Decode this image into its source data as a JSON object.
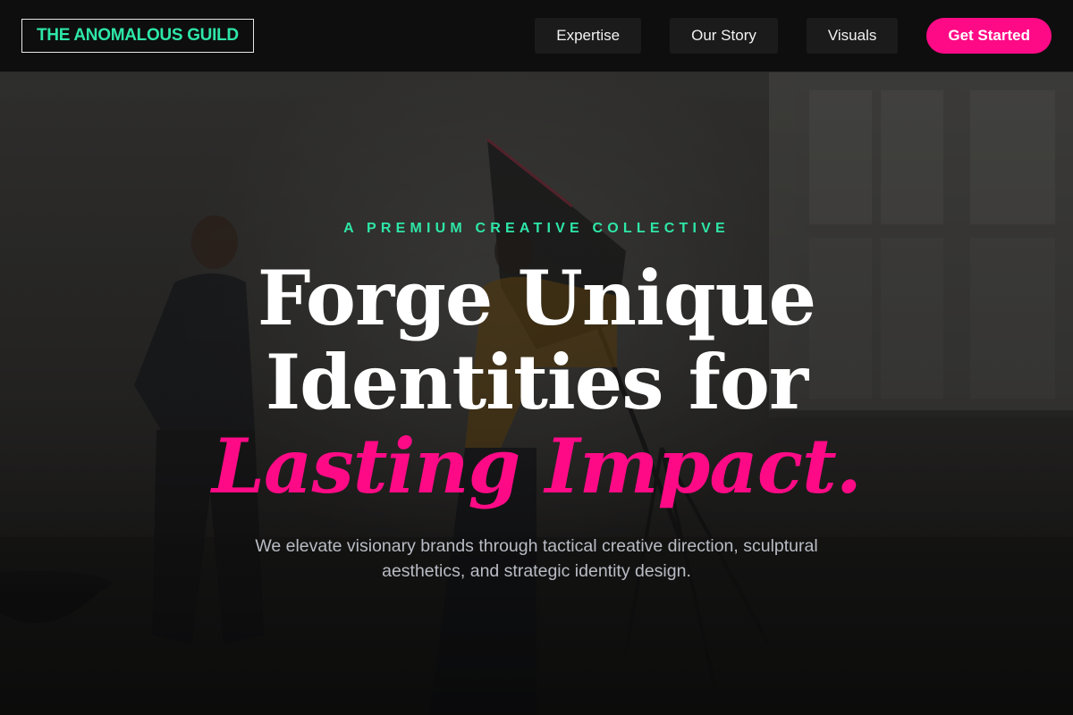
{
  "brand": {
    "name": "THE ANOMALOUS GUILD"
  },
  "nav": {
    "links": [
      {
        "label": "Expertise"
      },
      {
        "label": "Our Story"
      },
      {
        "label": "Visuals"
      }
    ],
    "cta_label": "Get Started"
  },
  "hero": {
    "eyebrow": "A PREMIUM CREATIVE COLLECTIVE",
    "headline_line1": "Forge Unique",
    "headline_line2": "Identities for",
    "headline_accent": "Lasting Impact.",
    "subtext": "We elevate visionary brands through tactical creative direction, sculptural aesthetics, and strategic identity design."
  },
  "colors": {
    "accent_green": "#2ee6a8",
    "accent_pink": "#ff0a86",
    "nav_background": "#0e0e0e",
    "text_white": "#ffffff",
    "text_muted": "#b9bcc4"
  }
}
